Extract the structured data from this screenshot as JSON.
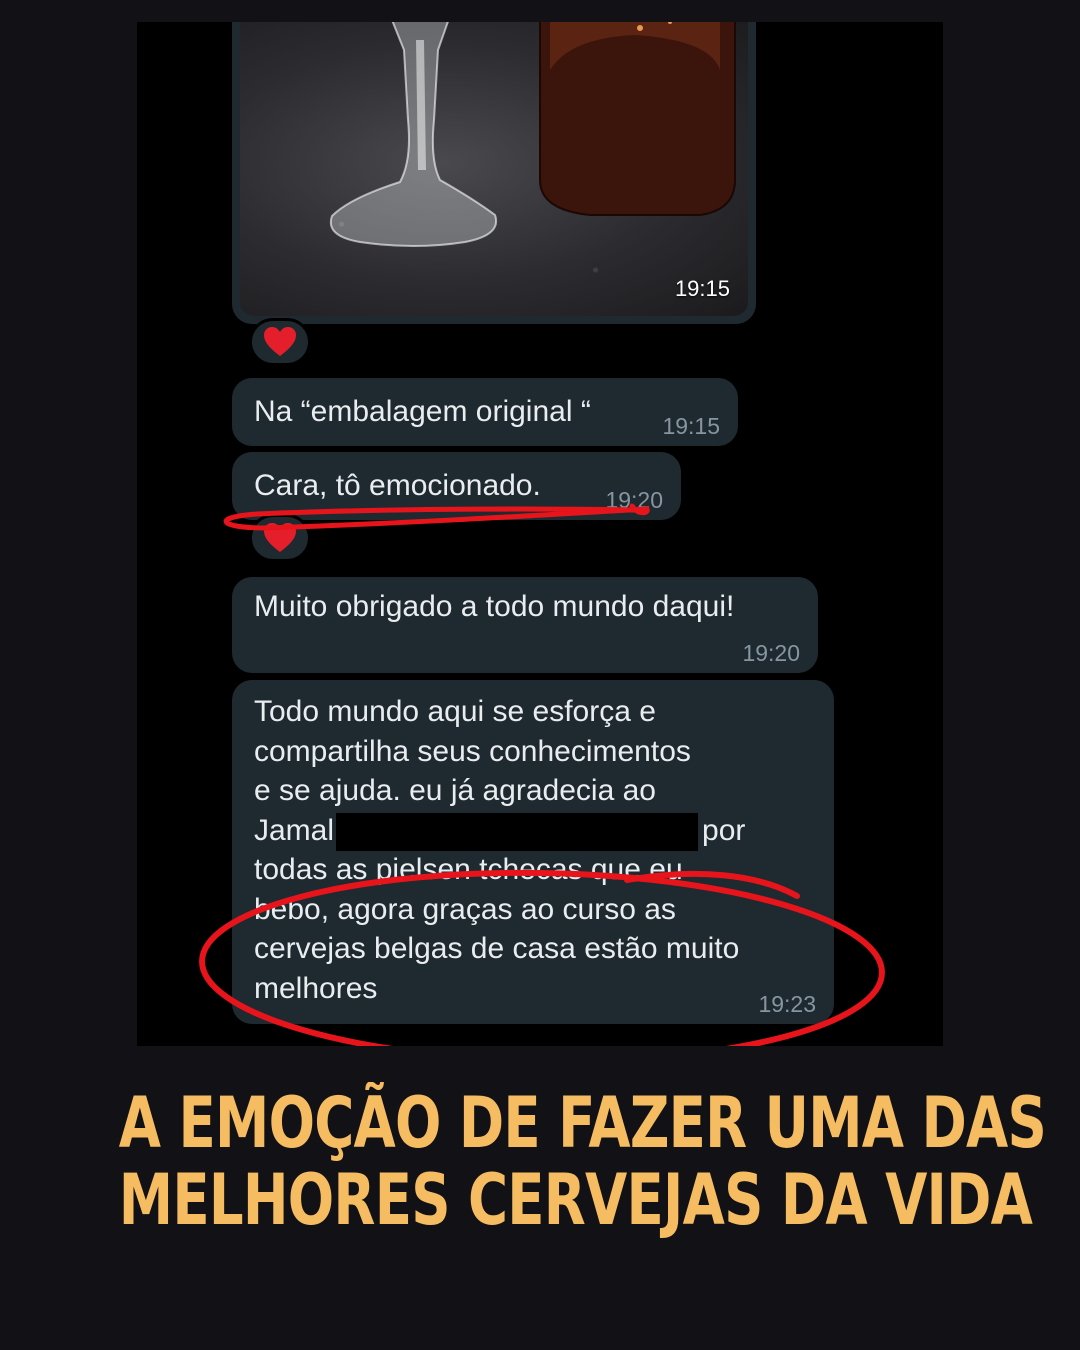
{
  "chat": {
    "photo_message": {
      "time": "19:15"
    },
    "messages": [
      {
        "text": "Na “embalagem original “",
        "time": "19:15"
      },
      {
        "text": "Cara, tô emocionado.",
        "time": "19:20"
      },
      {
        "text": "Muito obrigado a todo mundo daqui!",
        "time": "19:20"
      },
      {
        "lines": [
          "Todo mundo aqui se esforça e",
          "compartilha seus conhecimentos",
          "e se ajuda. eu já agradecia ao",
          "Jamal",
          "por",
          "todas as pielsen tchecas que eu",
          "bebo, agora graças ao curso as",
          "cervejas belgas de casa estão muito",
          "melhores"
        ],
        "time": "19:23"
      }
    ],
    "reactions": [
      "heart",
      "heart"
    ]
  },
  "colors": {
    "background": "#121216",
    "bubble": "#1f2a30",
    "annotation_red": "#e8141b",
    "headline": "#f6bc62"
  },
  "headline": {
    "line1": "A EMOÇÃO DE FAZER UMA DAS",
    "line2": "MELHORES CERVEJAS DA VIDA"
  }
}
